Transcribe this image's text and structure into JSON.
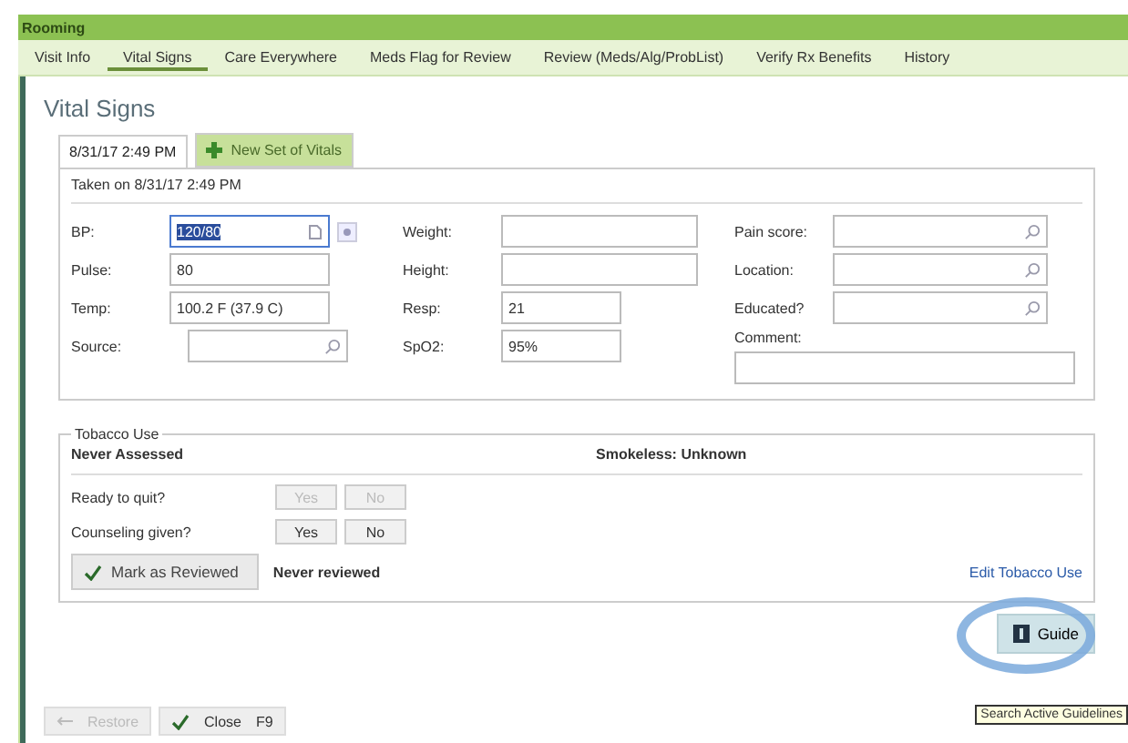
{
  "app_bar": {
    "title": "Rooming"
  },
  "tabs": [
    {
      "label": "Visit Info",
      "selected": false
    },
    {
      "label": "Vital Signs",
      "selected": true
    },
    {
      "label": "Care Everywhere",
      "selected": false
    },
    {
      "label": "Meds Flag for Review",
      "selected": false
    },
    {
      "label": "Review (Meds/Alg/ProbList)",
      "selected": false
    },
    {
      "label": "Verify Rx Benefits",
      "selected": false
    },
    {
      "label": "History",
      "selected": false
    }
  ],
  "section_title": "Vital Signs",
  "vitals_tabs": [
    {
      "label": "8/31/17 2:49 PM",
      "kind": "set",
      "selected": true
    },
    {
      "label": "New Set of Vitals",
      "kind": "add",
      "selected": false
    }
  ],
  "taken_on": "Taken on 8/31/17 2:49 PM",
  "columns": [
    [
      {
        "label": "BP:",
        "value": "120/80",
        "kind": "picker",
        "highlighted": true
      },
      {
        "label": "Pulse:",
        "value": "80",
        "kind": "text",
        "highlighted": false
      },
      {
        "label": "Temp:",
        "value": "100.2 F (37.9 C)",
        "kind": "text",
        "highlighted": false
      },
      {
        "label": "Source:",
        "kind": "lookup",
        "highlighted": false
      }
    ],
    [
      {
        "label": "Weight:",
        "kind": "text",
        "highlighted": false
      },
      {
        "label": "Height:",
        "kind": "text",
        "highlighted": false
      },
      {
        "label": "Resp:",
        "value": "21",
        "kind": "short",
        "highlighted": false
      },
      {
        "label": "SpO2:",
        "value": "95%",
        "kind": "short",
        "highlighted": false
      }
    ],
    [
      {
        "label": "Pain score:",
        "kind": "lookup",
        "highlighted": false
      },
      {
        "label": "Location:",
        "kind": "lookup",
        "highlighted": false
      },
      {
        "label": "Educated?",
        "kind": "lookup",
        "highlighted": false
      },
      {
        "label": "Comment:",
        "kind": "area",
        "highlighted": false
      }
    ]
  ],
  "tobacco": {
    "title": "Tobacco Use",
    "status": "Never Assessed",
    "smokeless": "Smokeless: Unknown",
    "questions": [
      {
        "label": "Ready to quit?",
        "disabled": true,
        "options": [
          "Yes",
          "No"
        ]
      },
      {
        "label": "Counseling given?",
        "disabled": false,
        "options": [
          "Yes",
          "No"
        ]
      }
    ],
    "review_button": "Mark as Reviewed",
    "review_status": "Never reviewed",
    "edit_link": "Edit Tobacco Use"
  },
  "guide_button": "Guide",
  "tooltip": "Search Active Guidelines",
  "footer_buttons": [
    {
      "label": "Restore",
      "kind": "restore",
      "disabled": true
    },
    {
      "label": "Close",
      "shortcut": "F9",
      "kind": "close",
      "disabled": false
    }
  ]
}
